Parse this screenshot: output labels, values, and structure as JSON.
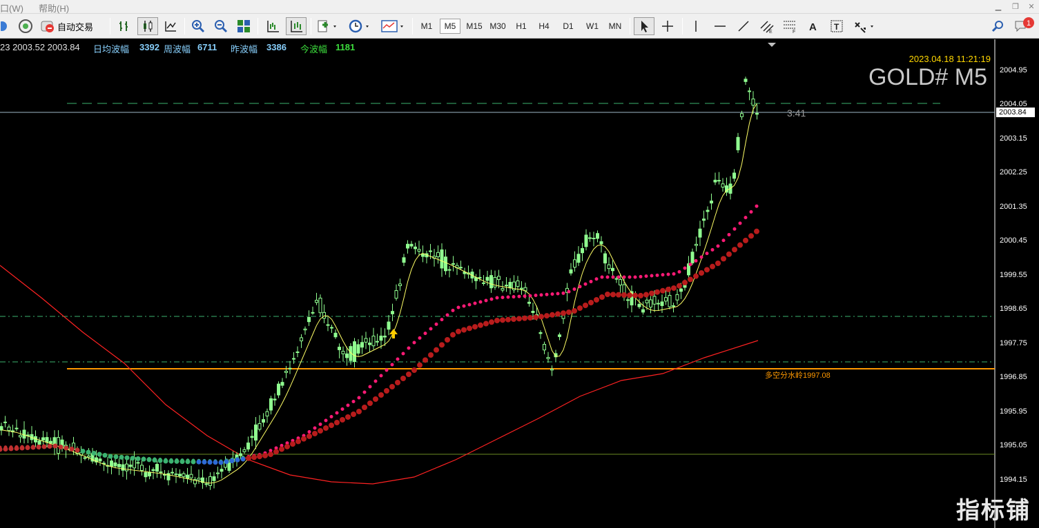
{
  "menu": {
    "items": [
      "口(W)",
      "帮助(H)"
    ]
  },
  "toolbar": {
    "auto_trade_label": "自动交易",
    "timeframes": [
      "M1",
      "M5",
      "M15",
      "M30",
      "H1",
      "H4",
      "D1",
      "W1",
      "MN"
    ],
    "active_timeframe": "M5",
    "notification_count": "1"
  },
  "chart": {
    "info": {
      "ohlc_text": "23 2003.52 2003.84",
      "daily_avg_label": "日均波幅",
      "daily_avg_value": "3392",
      "weekly_label": "周波幅",
      "weekly_value": "6711",
      "yesterday_label": "昨波幅",
      "yesterday_value": "3386",
      "today_label": "今波幅",
      "today_value": "1181"
    },
    "timestamp": "2023.04.18 11:21:19",
    "symbol": "GOLD# M5",
    "countdown": "3:41",
    "pivot_label": "多空分水岭1997.08",
    "current_price": "2003.84",
    "price_ticks": [
      "2004.95",
      "2004.05",
      "2003.15",
      "2002.25",
      "2001.35",
      "2000.45",
      "1999.55",
      "1998.65",
      "1997.75",
      "1996.85",
      "1995.95",
      "1995.05",
      "1994.15"
    ],
    "colors": {
      "candle": "#90ff90",
      "pivot_line": "#ff9900",
      "fast_ma": "#ffff66",
      "slow_ma": "#ff2222",
      "dot_fast": "#ff1a75",
      "dot_slow": "#b81c1c",
      "grid_dash": "#3cb371"
    }
  },
  "watermark": "指标铺"
}
